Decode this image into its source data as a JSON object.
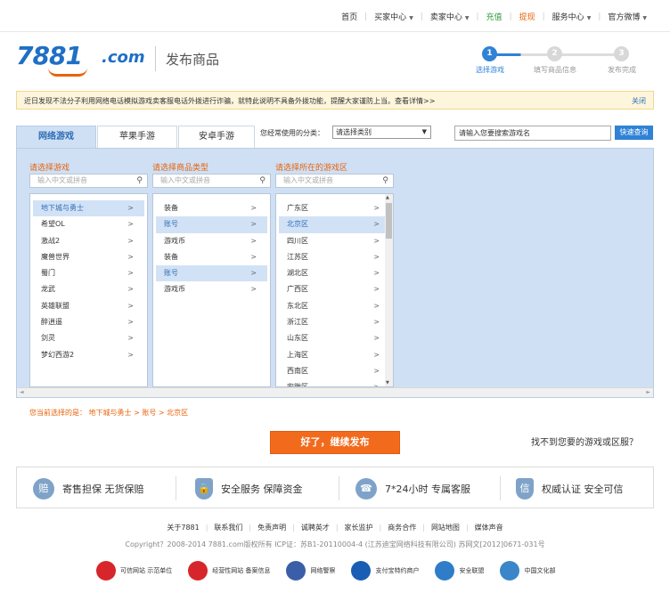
{
  "topnav": {
    "items": [
      {
        "label": "首页",
        "caret": false,
        "style": ""
      },
      {
        "label": "买家中心",
        "caret": true,
        "style": ""
      },
      {
        "label": "卖家中心",
        "caret": true,
        "style": ""
      },
      {
        "label": "充值",
        "caret": false,
        "style": "green"
      },
      {
        "label": "提现",
        "caret": false,
        "style": "hl"
      },
      {
        "label": "服务中心",
        "caret": true,
        "style": ""
      },
      {
        "label": "官方微博",
        "caret": true,
        "style": ""
      }
    ]
  },
  "header": {
    "logo_num": "7881",
    "logo_com": ".com",
    "page_title": "发布商品"
  },
  "steps": [
    {
      "num": "1",
      "label": "选择游戏",
      "active": true
    },
    {
      "num": "2",
      "label": "填写商品信息",
      "active": false
    },
    {
      "num": "3",
      "label": "发布完成",
      "active": false
    }
  ],
  "notice": {
    "text": "近日发现不法分子利用网络电话模拟游戏卖客服电话外拨进行诈骗，就特此说明不具备外拨功能，提醒大家谨防上当。查看详情>>",
    "close": "关闭"
  },
  "tabs": [
    "网络游戏",
    "苹果手游",
    "安卓手游"
  ],
  "category": {
    "label": "您经常使用的分类：",
    "select_value": "请选择类别"
  },
  "search": {
    "placeholder": "请输入您要搜索游戏名",
    "button": "快速查询"
  },
  "columns": {
    "game": {
      "title": "请选择游戏",
      "placeholder": "输入中文或拼音",
      "items": [
        "地下城与勇士",
        "希望OL",
        "激战2",
        "魔兽世界",
        "蜀门",
        "龙武",
        "英雄联盟",
        "醉逍遥",
        "剑灵",
        "梦幻西游2"
      ],
      "selected": 0
    },
    "type": {
      "title": "请选择商品类型",
      "placeholder": "输入中文或拼音",
      "items": [
        "装备",
        "账号",
        "游戏币",
        "装备",
        "账号",
        "游戏币"
      ],
      "selected": [
        1,
        4
      ]
    },
    "region": {
      "title": "请选择所在的游戏区",
      "placeholder": "输入中文或拼音",
      "items": [
        "广东区",
        "北京区",
        "四川区",
        "江苏区",
        "湖北区",
        "广西区",
        "东北区",
        "浙江区",
        "山东区",
        "上海区",
        "西南区",
        "安徽区"
      ],
      "selected": 1
    }
  },
  "current_selection": "您当前选择的是：   地下城与勇士  >  账号  >  北京区",
  "publish_button": "好了，继续发布",
  "not_found": "找不到您要的游戏或区服？",
  "guarantees": [
    {
      "icon": "赔",
      "text": "寄售担保  无货保赔"
    },
    {
      "icon": "盾",
      "text": "安全服务  保障资金"
    },
    {
      "icon": "☎",
      "text": "7*24小时  专属客服"
    },
    {
      "icon": "信",
      "text": "权威认证  安全可信"
    }
  ],
  "footer": {
    "links": [
      "关于7881",
      "联系我们",
      "免责声明",
      "诚聘英才",
      "家长监护",
      "商务合作",
      "网站地图",
      "媒体声音"
    ],
    "copyright": "Copyright？2008-2014 7881.com版权所有  ICP证：苏B1-20110004-4 (江苏迪宝网络科技有限公司)   苏网文[2012]0671-031号",
    "badges": [
      {
        "text": "可信网站 示范单位",
        "color": "#d7262b"
      },
      {
        "text": "经营性网站 备案信息",
        "color": "#d7262b"
      },
      {
        "text": "网络警察",
        "color": "#3b5ea8"
      },
      {
        "text": "支付宝特约商户",
        "color": "#1a5db5"
      },
      {
        "text": "安全联盟",
        "color": "#2f7dc8"
      },
      {
        "text": "中国文化部",
        "color": "#3a86c9"
      }
    ]
  }
}
